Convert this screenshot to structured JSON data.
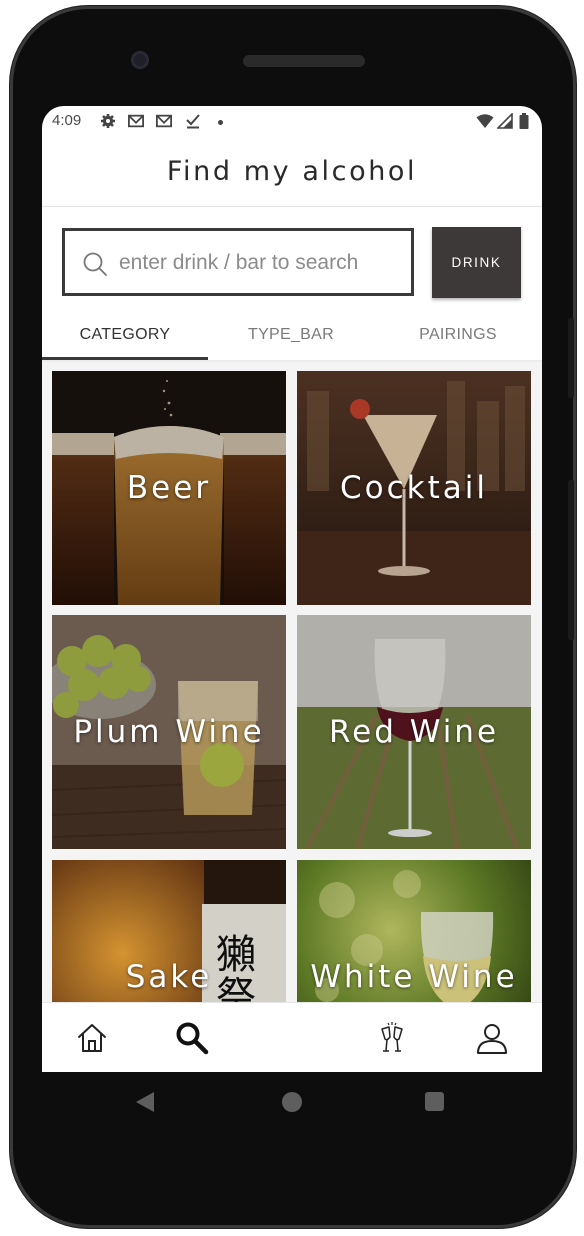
{
  "status": {
    "time": "4:09"
  },
  "app": {
    "title": "Find my alcohol"
  },
  "search": {
    "placeholder": "enter drink / bar to search",
    "button_label": "DRINK"
  },
  "tabs": [
    {
      "label": "CATEGORY",
      "selected": true
    },
    {
      "label": "TYPE_BAR",
      "selected": false
    },
    {
      "label": "PAIRINGS",
      "selected": false
    }
  ],
  "categories": [
    {
      "label": "Beer"
    },
    {
      "label": "Cocktail"
    },
    {
      "label": "Plum Wine"
    },
    {
      "label": "Red Wine"
    },
    {
      "label": "Sake"
    },
    {
      "label": "White Wine"
    }
  ],
  "bottom_nav": [
    {
      "icon": "home-icon",
      "selected": false
    },
    {
      "icon": "search-icon",
      "selected": true
    },
    {
      "icon": "plus-icon",
      "selected": false
    },
    {
      "icon": "cheers-icon",
      "selected": false
    },
    {
      "icon": "profile-icon",
      "selected": false
    }
  ],
  "colors": {
    "accent_dark": "#3d3938",
    "text_primary": "#2a2a2a",
    "plus_gradient": [
      "#9ec8ff",
      "#e3a9ff"
    ]
  }
}
